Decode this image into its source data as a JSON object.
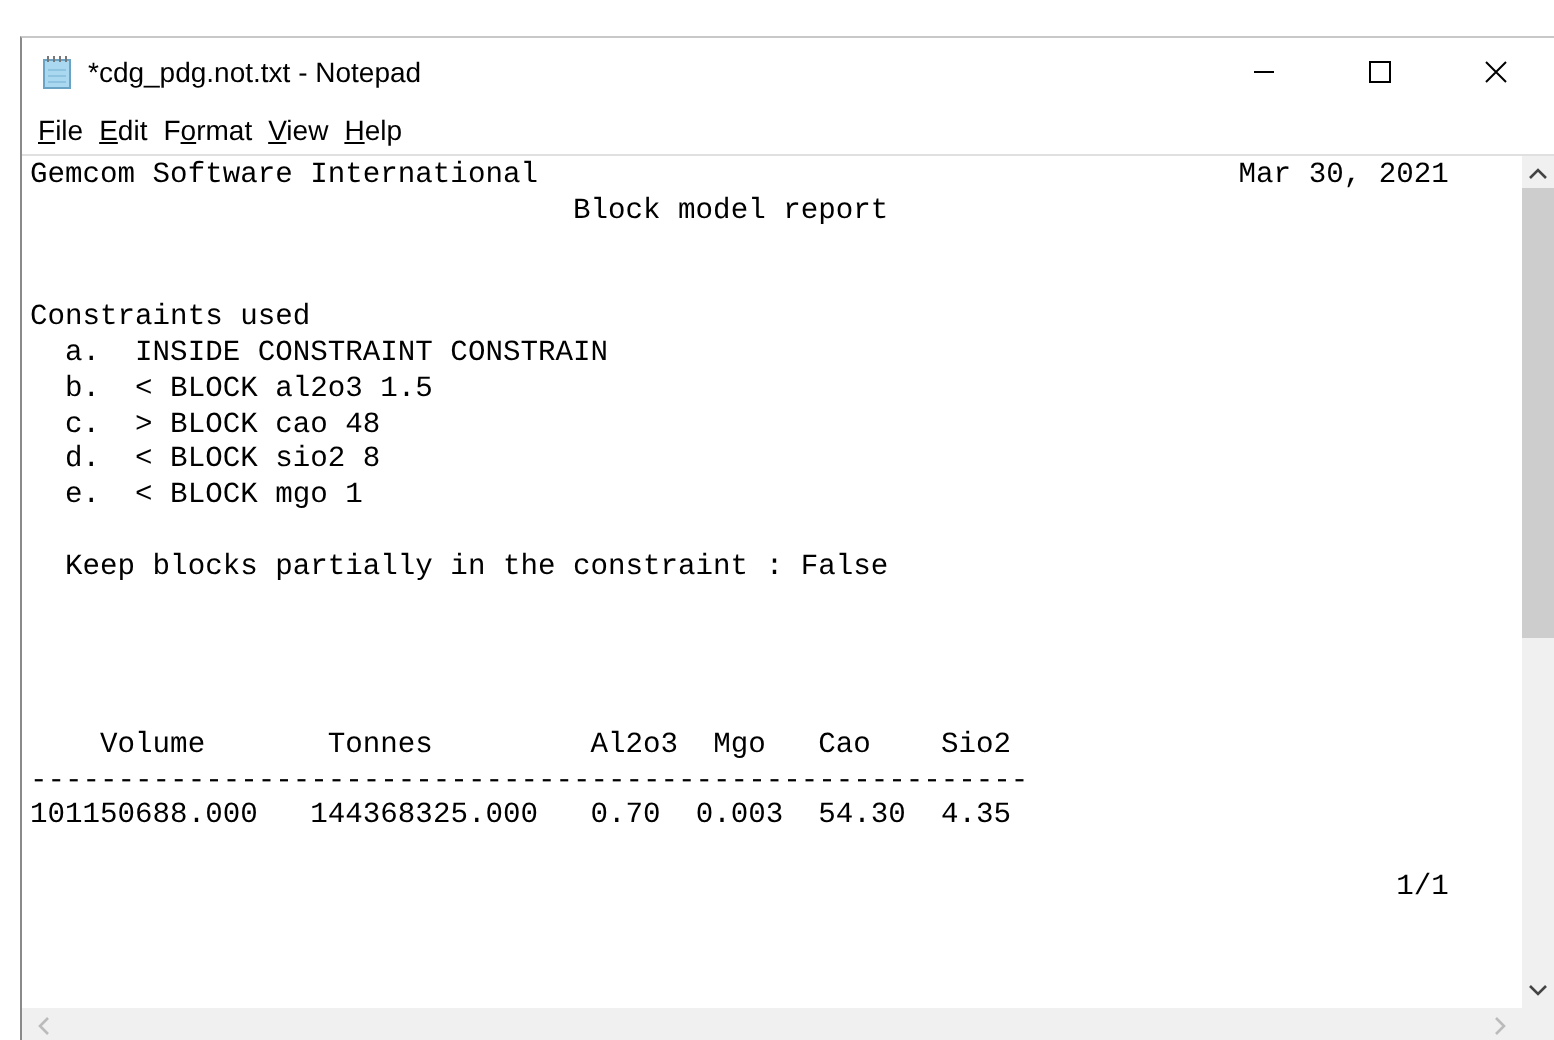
{
  "window": {
    "title": "*cdg_pdg.not.txt - Notepad"
  },
  "menu": [
    {
      "key": "F",
      "after": "ile"
    },
    {
      "key": "E",
      "after": "dit"
    },
    {
      "before": "F",
      "key": "o",
      "after": "rmat"
    },
    {
      "key": "V",
      "after": "iew"
    },
    {
      "key": "H",
      "after": "elp"
    }
  ],
  "document": {
    "text": "Gemcom Software International                                        Mar 30, 2021\n                               Block model report\n\n\nConstraints used\n  a.  INSIDE CONSTRAINT CONSTRAIN\n  b.  < BLOCK al2o3 1.5\n  c.  > BLOCK cao 48\n  d.  < BLOCK sio2 8\n  e.  < BLOCK mgo 1\n\n  Keep blocks partially in the constraint : False\n\n\n\n\n    Volume       Tonnes         Al2o3  Mgo   Cao    Sio2\n---------------------------------------------------------\n101150688.000   144368325.000   0.70  0.003  54.30  4.35\n\n                                                                              1/1"
  }
}
